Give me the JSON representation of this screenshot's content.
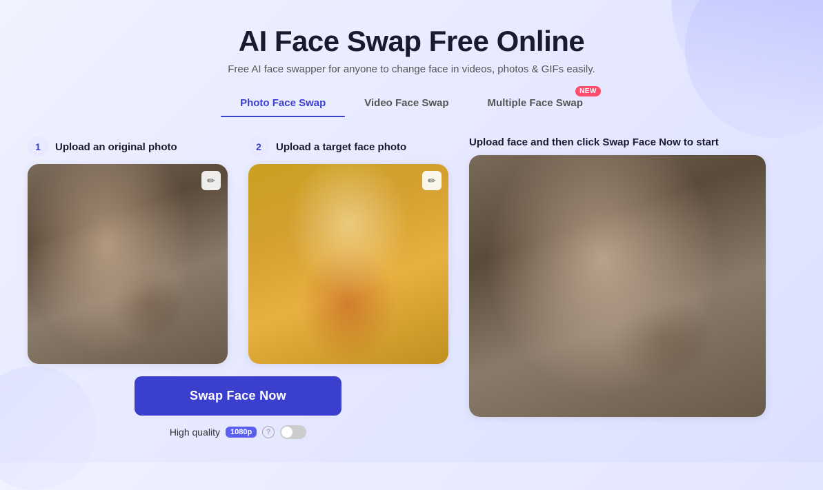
{
  "header": {
    "title": "AI Face Swap Free Online",
    "subtitle": "Free AI face swapper for anyone to change face in videos, photos & GIFs easily."
  },
  "tabs": [
    {
      "id": "photo",
      "label": "Photo Face Swap",
      "active": true,
      "new": false
    },
    {
      "id": "video",
      "label": "Video Face Swap",
      "active": false,
      "new": false
    },
    {
      "id": "multiple",
      "label": "Multiple Face Swap",
      "active": false,
      "new": true
    }
  ],
  "steps": [
    {
      "number": "1",
      "label": "Upload an original photo"
    },
    {
      "number": "2",
      "label": "Upload a target face photo"
    }
  ],
  "result_label": "Upload face and then click Swap Face Now to start",
  "swap_button": "Swap Face Now",
  "quality": {
    "label": "High quality",
    "badge": "1080p"
  },
  "icons": {
    "edit": "✏",
    "help": "?",
    "new_badge": "NEW"
  }
}
